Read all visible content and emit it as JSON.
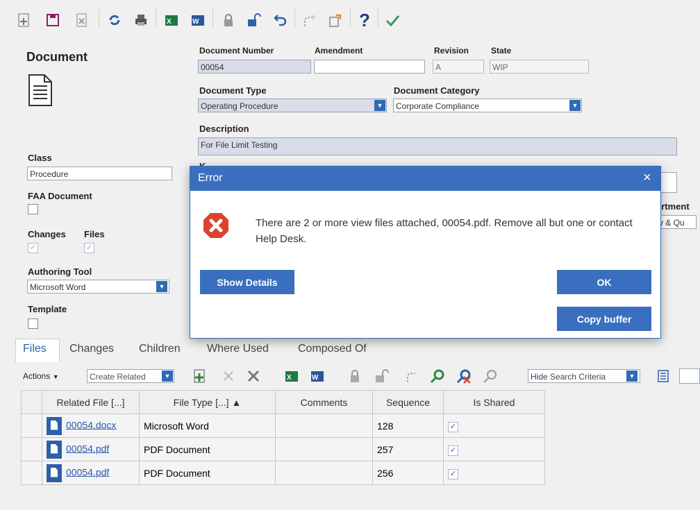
{
  "form": {
    "title": "Document",
    "doc_number_label": "Document Number",
    "doc_number_value": "00054",
    "amendment_label": "Amendment",
    "amendment_value": "",
    "revision_label": "Revision",
    "revision_value": "A",
    "state_label": "State",
    "state_value": "WIP",
    "doc_type_label": "Document Type",
    "doc_type_value": "Operating Procedure",
    "doc_category_label": "Document Category",
    "doc_category_value": "Corporate Compliance",
    "description_label": "Description",
    "description_value": "For File Limit Testing",
    "keywords_label_partial": "K",
    "class_label": "Class",
    "class_value": "Procedure",
    "faa_label": "FAA Document",
    "changes_label": "Changes",
    "files_label": "Files",
    "authoring_tool_label": "Authoring Tool",
    "authoring_tool_value": "Microsoft Word",
    "template_label": "Template",
    "department_label_partial": "artment",
    "department_value_partial": "y & Qu"
  },
  "tabs": [
    "Files",
    "Changes",
    "Children",
    "Where Used",
    "Composed Of"
  ],
  "grid_toolbar": {
    "actions_label": "Actions",
    "create_related_label": "Create Related",
    "hide_search_label": "Hide Search Criteria"
  },
  "grid": {
    "headers": [
      "Related File [...]",
      "File Type [...] ▲",
      "Comments",
      "Sequence",
      "Is Shared"
    ],
    "rows": [
      {
        "file": "00054.docx",
        "type": "Microsoft Word",
        "comments": "",
        "sequence": "128",
        "shared": true
      },
      {
        "file": "00054.pdf",
        "type": "PDF Document",
        "comments": "",
        "sequence": "257",
        "shared": true
      },
      {
        "file": "00054.pdf",
        "type": "PDF Document",
        "comments": "",
        "sequence": "256",
        "shared": true
      }
    ]
  },
  "dialog": {
    "title": "Error",
    "close_glyph": "×",
    "message": "There are 2 or more view files attached, 00054.pdf. Remove all but one or contact Help Desk.",
    "show_details_label": "Show Details",
    "ok_label": "OK",
    "copy_buffer_label": "Copy buffer"
  },
  "colors": {
    "accent": "#3a6fbf",
    "dropdown": "#2e6bb5",
    "error_red": "#d9432f",
    "excel_green": "#1e7a44",
    "word_blue": "#2b579a"
  },
  "icons": [
    "add-document-icon",
    "save-icon",
    "discard-icon",
    "refresh-icon",
    "print-icon",
    "excel-icon",
    "word-icon",
    "lock-icon",
    "unlock-icon",
    "undo-icon",
    "redirect-icon",
    "export-icon",
    "help-icon",
    "check-icon"
  ]
}
